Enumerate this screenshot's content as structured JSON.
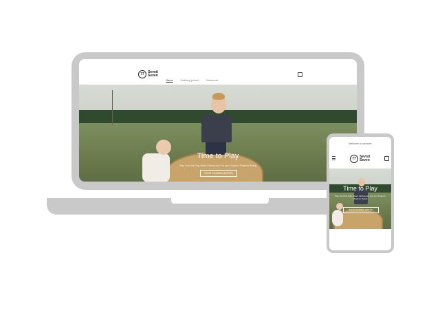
{
  "site": {
    "brand_line1": "Sevnti",
    "brand_line2": "Seven",
    "brand_badge": "77",
    "announcement": "Welcome to our store",
    "nav": [
      "Home",
      "Clothing (other)",
      "Seasonal"
    ],
    "hero_title": "Time to Play",
    "hero_subtitle": "Stay Cool this Play-Wear! Clothes are Fun and Outdoor. Playtime Ready",
    "hero_button": "SHOP CLOSING (EVENT)",
    "hero_button_mobile": "SHOP CLOSING (EVENT)"
  },
  "colors": {
    "device_frame": "#c9c9c9",
    "background": "#ffffff"
  },
  "icons": {
    "cart": "cart-icon",
    "menu": "hamburger-menu-icon"
  }
}
